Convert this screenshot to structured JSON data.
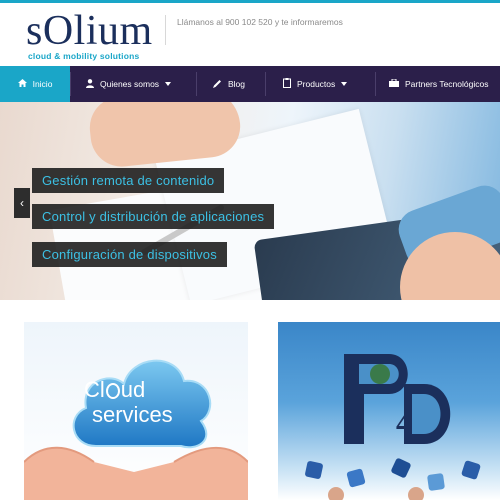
{
  "header": {
    "logo_word": "sOlium",
    "logo_tagline": "cloud & mobility solutions",
    "phone_text": "Llámanos al 900 102 520 y te informaremos"
  },
  "nav": {
    "items": [
      {
        "label": "Inicio",
        "icon": "home-icon",
        "active": true
      },
      {
        "label": "Quienes somos",
        "icon": "user-icon",
        "dropdown": true
      },
      {
        "label": "Blog",
        "icon": "pencil-icon"
      },
      {
        "label": "Productos",
        "icon": "clipboard-icon",
        "dropdown": true
      },
      {
        "label": "Partners Tecnológicos",
        "icon": "briefcase-icon"
      }
    ]
  },
  "hero": {
    "captions": [
      "Gestión remota de contenido",
      "Control y distribución de aplicaciones",
      "Configuración de dispositivos"
    ],
    "prev_arrow": "‹"
  },
  "cards": {
    "cloud_word1": "Cl",
    "cloud_word1b": "ud",
    "cloud_word2": "services",
    "p4d_number": "4"
  },
  "colors": {
    "accent": "#1aa6c8",
    "nav_bg": "#2b1f4a",
    "brand_dark": "#1b2f5c",
    "caption_text": "#3cc0e4"
  }
}
